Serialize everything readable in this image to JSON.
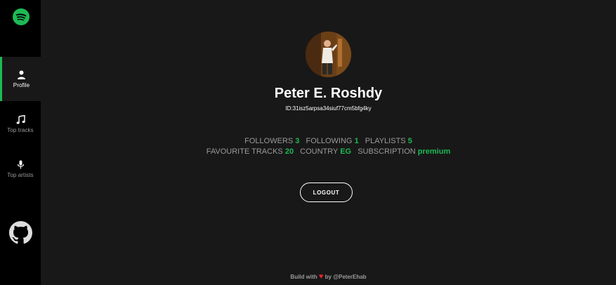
{
  "sidebar": {
    "logo_icon": "spotify-icon",
    "items": [
      {
        "label": "Profile",
        "icon": "user-icon",
        "active": true
      },
      {
        "label": "Top tracks",
        "icon": "music-note-icon",
        "active": false
      },
      {
        "label": "Top artists",
        "icon": "microphone-icon",
        "active": false
      }
    ],
    "github_icon": "github-icon"
  },
  "profile": {
    "name": "Peter E. Roshdy",
    "id_text": "ID:31isz5arpsa34siuf77cm5bfg4ky",
    "stats_row1": [
      {
        "label": "FOLLOWERS",
        "value": "3"
      },
      {
        "label": "FOLLOWING",
        "value": "1"
      },
      {
        "label": "PLAYLISTS",
        "value": "5"
      }
    ],
    "stats_row2": [
      {
        "label": "FAVOURITE TRACKS",
        "value": "20"
      },
      {
        "label": "COUNTRY",
        "value": "EG"
      },
      {
        "label": "SUBSCRIPTION",
        "value": "premium"
      }
    ],
    "logout_label": "LOGOUT"
  },
  "footer": {
    "prefix": "Build with",
    "suffix": "by @PeterEhab"
  },
  "colors": {
    "accent": "#1db954",
    "background": "#181818",
    "sidebar": "#000000",
    "heart": "#e8232a"
  }
}
